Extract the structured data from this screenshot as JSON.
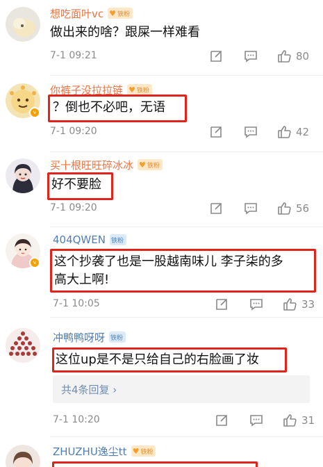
{
  "comments": [
    {
      "username": "想吃面叶vc",
      "badge": "铁粉",
      "text": "做出来的啥？跟屎一样难看",
      "time": "7-1 09:21",
      "likes": "80"
    },
    {
      "username": "你裤子没拉拉链",
      "badge": "铁粉",
      "text": "？倒也不必吧，无语",
      "time": "7-1 09:20",
      "likes": "42"
    },
    {
      "username": "买十根旺旺碎冰冰",
      "badge": "铁粉",
      "text": "好不要脸",
      "time": "7-1 09:20",
      "likes": "56"
    },
    {
      "username": "404QWEN",
      "badge": "铁粉",
      "text_line1": "这个抄袭了也是一股越南味儿  李子柒的多",
      "text_line2": "高大上啊!",
      "time": "7-1 10:05",
      "likes": "33"
    },
    {
      "username": "冲鸭鸭呀呀",
      "badge": "铁粉",
      "text": "这位up是不是只给自己的右脸画了妆",
      "reply_link": "共4条回复 ›",
      "time": "7-1 10:20",
      "likes": "31"
    },
    {
      "username": "ZHUZHU逸尘tt",
      "badge": "铁粉"
    }
  ],
  "colors": {
    "highlight": "#e0231b",
    "username_orange": "#eb7340",
    "username_blue": "#507daf",
    "meta_gray": "#8a8a8a"
  }
}
